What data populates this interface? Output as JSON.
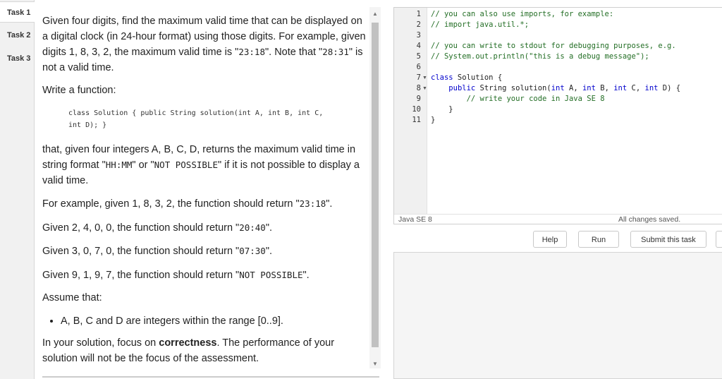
{
  "tabs": [
    "Task 1",
    "Task 2",
    "Task 3"
  ],
  "description": {
    "intro_1": "Given four digits, find the maximum valid time that can be displayed on a digital clock (in 24-hour format) using those digits. For example, given digits 1, 8, 3, 2, the maximum valid time is \"",
    "intro_code_1": "23:18",
    "intro_2": "\". Note that \"",
    "intro_code_2": "28:31",
    "intro_3": "\" is not a valid time.",
    "write_fn": "Write a function:",
    "signature": "class Solution { public String solution(int A, int B, int C, int D); }",
    "returns_1": "that, given four integers A, B, C, D, returns the maximum valid time in string format \"",
    "returns_code_1": "HH:MM",
    "returns_2": "\" or \"",
    "returns_code_2": "NOT POSSIBLE",
    "returns_3": "\" if it is not possible to display a valid time.",
    "examples": [
      {
        "pre": "For example, given 1, 8, 3, 2, the function should return \"",
        "code": "23:18",
        "post": "\"."
      },
      {
        "pre": "Given 2, 4, 0, 0, the function should return \"",
        "code": "20:40",
        "post": "\"."
      },
      {
        "pre": "Given 3, 0, 7, 0, the function should return \"",
        "code": "07:30",
        "post": "\"."
      },
      {
        "pre": "Given 9, 1, 9, 7, the function should return \"",
        "code": "NOT POSSIBLE",
        "post": "\"."
      }
    ],
    "assume": "Assume that:",
    "assume_bullet": "A, B, C and D are integers within the range [0..9].",
    "focus_1": "In your solution, focus on ",
    "focus_bold": "correctness",
    "focus_2": ". The performance of your solution will not be the focus of the assessment."
  },
  "editor": {
    "line_numbers": [
      "1",
      "2",
      "3",
      "4",
      "5",
      "6",
      "7",
      "8",
      "9",
      "10",
      "11"
    ],
    "comment_1": "// you can also use imports, for example:",
    "comment_2": "// import java.util.*;",
    "comment_4": "// you can write to stdout for debugging purposes, e.g.",
    "comment_5": "// System.out.println(\"this is a debug message\");",
    "kw_class": "class",
    "class_name": " Solution {",
    "kw_public": "public",
    "method_rest_1": " String solution(",
    "kw_int": "int",
    "param_a": " A, ",
    "param_b": " B, ",
    "param_c": " C, ",
    "param_d": " D) {",
    "comment_9": "// write your code in Java SE 8",
    "close_method": "}",
    "close_class": "}",
    "language": "Java SE 8",
    "save_status": "All changes saved."
  },
  "buttons": {
    "help": "Help",
    "run": "Run",
    "submit": "Submit this task"
  }
}
